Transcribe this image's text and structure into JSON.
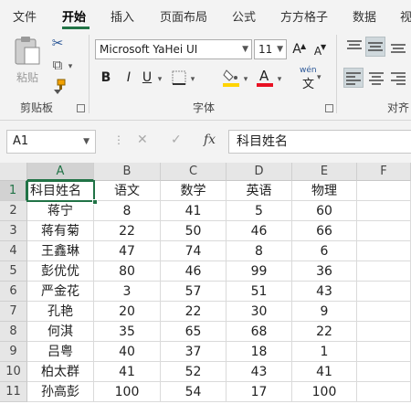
{
  "ribbon_tabs": [
    {
      "label": "文件"
    },
    {
      "label": "开始"
    },
    {
      "label": "插入"
    },
    {
      "label": "页面布局"
    },
    {
      "label": "公式"
    },
    {
      "label": "方方格子"
    },
    {
      "label": "数据"
    },
    {
      "label": "视"
    }
  ],
  "clipboard": {
    "paste_label": "粘贴",
    "group_label": "剪贴板"
  },
  "font": {
    "name": "Microsoft YaHei UI",
    "size": "11",
    "group_label": "字体",
    "bold": "B",
    "italic": "I",
    "underline": "U",
    "grow": "A",
    "shrink": "A",
    "phonetic": "wén",
    "font_color_letter": "A"
  },
  "alignment": {
    "group_label": "对齐"
  },
  "formula_bar": {
    "name_box": "A1",
    "cancel": "✕",
    "enter": "✓",
    "fx": "fx",
    "content": "科目姓名"
  },
  "columns": [
    "A",
    "B",
    "C",
    "D",
    "E",
    "F"
  ],
  "rows": [
    "1",
    "2",
    "3",
    "4",
    "5",
    "6",
    "7",
    "8",
    "9",
    "10",
    "11"
  ],
  "table": {
    "header": [
      "科目姓名",
      "语文",
      "数学",
      "英语",
      "物理"
    ],
    "rows": [
      [
        "蒋宁",
        "8",
        "41",
        "5",
        "60"
      ],
      [
        "蒋有菊",
        "22",
        "50",
        "46",
        "66"
      ],
      [
        "王鑫琳",
        "47",
        "74",
        "8",
        "6"
      ],
      [
        "彭优优",
        "80",
        "46",
        "99",
        "36"
      ],
      [
        "严金花",
        "3",
        "57",
        "51",
        "43"
      ],
      [
        "孔艳",
        "20",
        "22",
        "30",
        "9"
      ],
      [
        "何淇",
        "35",
        "65",
        "68",
        "22"
      ],
      [
        "吕粤",
        "40",
        "37",
        "18",
        "1"
      ],
      [
        "柏太群",
        "41",
        "52",
        "43",
        "41"
      ],
      [
        "孙高彭",
        "100",
        "54",
        "17",
        "100"
      ]
    ]
  },
  "colors": {
    "accent": "#217346",
    "highlight": "#ffd400",
    "font_color": "#e81123"
  }
}
